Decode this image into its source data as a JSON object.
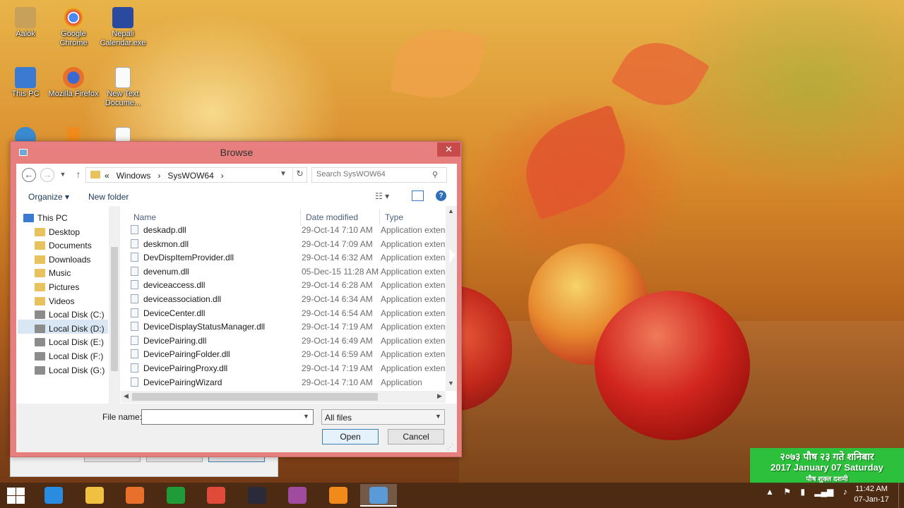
{
  "desktop": {
    "icons": [
      {
        "label": "Aalok",
        "icon": "user-folder-icon"
      },
      {
        "label": "Google Chrome",
        "icon": "chrome-icon"
      },
      {
        "label": "Nepali Calendar.exe",
        "icon": "nepali-calendar-icon"
      },
      {
        "label": "This PC",
        "icon": "computer-icon"
      },
      {
        "label": "Mozilla Firefox",
        "icon": "firefox-icon"
      },
      {
        "label": "New Text Docume...",
        "icon": "text-document-icon"
      }
    ]
  },
  "dialog": {
    "title": "Browse",
    "close_symbol": "✕",
    "address": {
      "prefix": "«",
      "crumbs": [
        "Windows",
        "SysWOW64"
      ],
      "separator": "›"
    },
    "search_placeholder": "Search SysWOW64",
    "toolbar": {
      "organize_label": "Organize ▾",
      "new_folder_label": "New folder",
      "view_label": "☷ ▾"
    },
    "nav_tree": [
      {
        "label": "This PC",
        "icon": "computer-icon"
      },
      {
        "label": "Desktop",
        "icon": "desktop-folder-icon"
      },
      {
        "label": "Documents",
        "icon": "documents-folder-icon"
      },
      {
        "label": "Downloads",
        "icon": "downloads-folder-icon"
      },
      {
        "label": "Music",
        "icon": "music-folder-icon"
      },
      {
        "label": "Pictures",
        "icon": "pictures-folder-icon"
      },
      {
        "label": "Videos",
        "icon": "videos-folder-icon"
      },
      {
        "label": "Local Disk (C:)",
        "icon": "drive-icon",
        "selected": true
      },
      {
        "label": "Local Disk (D:)",
        "icon": "drive-icon"
      },
      {
        "label": "Local Disk (E:)",
        "icon": "drive-icon"
      },
      {
        "label": "Local Disk (F:)",
        "icon": "drive-icon"
      },
      {
        "label": "Local Disk (G:)",
        "icon": "drive-icon"
      }
    ],
    "columns": [
      "Name",
      "Date modified",
      "Type"
    ],
    "files": [
      {
        "name": "deskadp.dll",
        "date": "29-Oct-14 7:10 AM",
        "type": "Application exten"
      },
      {
        "name": "deskmon.dll",
        "date": "29-Oct-14 7:09 AM",
        "type": "Application exten"
      },
      {
        "name": "DevDispItemProvider.dll",
        "date": "29-Oct-14 6:32 AM",
        "type": "Application exten"
      },
      {
        "name": "devenum.dll",
        "date": "05-Dec-15 11:28 AM",
        "type": "Application exten"
      },
      {
        "name": "deviceaccess.dll",
        "date": "29-Oct-14 6:28 AM",
        "type": "Application exten"
      },
      {
        "name": "deviceassociation.dll",
        "date": "29-Oct-14 6:34 AM",
        "type": "Application exten"
      },
      {
        "name": "DeviceCenter.dll",
        "date": "29-Oct-14 6:54 AM",
        "type": "Application exten"
      },
      {
        "name": "DeviceDisplayStatusManager.dll",
        "date": "29-Oct-14 7:19 AM",
        "type": "Application exten"
      },
      {
        "name": "DevicePairing.dll",
        "date": "29-Oct-14 6:49 AM",
        "type": "Application exten"
      },
      {
        "name": "DevicePairingFolder.dll",
        "date": "29-Oct-14 6:59 AM",
        "type": "Application exten"
      },
      {
        "name": "DevicePairingProxy.dll",
        "date": "29-Oct-14 7:19 AM",
        "type": "Application exten"
      },
      {
        "name": "DevicePairingWizard",
        "date": "29-Oct-14 7:10 AM",
        "type": "Application"
      }
    ],
    "footer": {
      "file_name_label": "File name:",
      "file_name_value": "",
      "filter_value": "All files",
      "open_label": "Open",
      "cancel_label": "Cancel"
    }
  },
  "calendar_widget": {
    "line1": "२०७३ पौष २३ गते शनिबार",
    "line2": "2017 January 07 Saturday",
    "line3": "पौष शुक्ल दशमी"
  },
  "taskbar": {
    "apps": [
      {
        "name": "internet-explorer-icon",
        "color": "#2a8ce0"
      },
      {
        "name": "file-explorer-icon",
        "color": "#f0c040"
      },
      {
        "name": "firefox-icon",
        "color": "#e8702a"
      },
      {
        "name": "store-icon",
        "color": "#1f9b3a"
      },
      {
        "name": "chrome-icon",
        "color": "#e04a3a"
      },
      {
        "name": "media-player-icon",
        "color": "#2a2a3a"
      },
      {
        "name": "photo-app-icon",
        "color": "#a04aa0"
      },
      {
        "name": "vlc-icon",
        "color": "#f08a1a"
      },
      {
        "name": "dialog-window-icon",
        "color": "#5a9ad8",
        "active": true
      }
    ],
    "clock_time": "11:42 AM",
    "clock_date": "07-Jan-17"
  }
}
